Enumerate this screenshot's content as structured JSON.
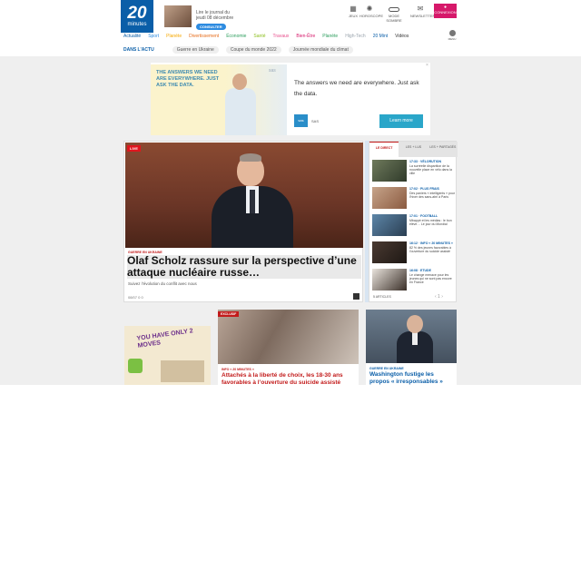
{
  "header": {
    "logo_number": "20",
    "logo_word": "minutes",
    "journal_line1": "Lire le journal du",
    "journal_line2": "jeudi 08 décembre",
    "journal_button": "CONSULTER",
    "tools": [
      {
        "label": "JEUX",
        "icon": "games-icon"
      },
      {
        "label": "HOROSCOPE",
        "icon": "horoscope-icon"
      },
      {
        "label": "MODE SOMBRE",
        "icon": "dark-mode-toggle-icon"
      },
      {
        "label": "NEWSLETTERS",
        "icon": "mail-icon"
      }
    ],
    "login_label": "CONNEXION",
    "nav": [
      "Actualité",
      "Sport",
      "Planète",
      "Voyages",
      "Divertissement",
      "Économie",
      "Santé",
      "Travaux",
      "Bien-Être",
      "Planète",
      "High-Tech",
      "Par Ici",
      "20 Mint",
      "Vidéos"
    ],
    "nav_more_label": "MENU",
    "actu_label": "DANS L'ACTU",
    "actu_pills": [
      "Guerre en Ukraine",
      "Coupe du monde 2022",
      "Journée mondiale du climat"
    ]
  },
  "ad": {
    "headline": "THE ANSWERS WE NEED ARE EVERYWHERE. JUST ASK THE DATA.",
    "brand_small": "sas",
    "text": "The answers we need are everywhere. Just ask the data.",
    "logo": "sas",
    "brand": "SAS",
    "cta": "Learn more",
    "close": "×"
  },
  "main_story": {
    "live_badge": "LIVE",
    "category": "GUERRE EN UKRAINE",
    "title": "Olaf Scholz rassure sur la perspective d’une attaque nucléaire russe…",
    "subtitle": "Suivez l’évolution du conflit avec nous",
    "stats": "08/07  0  0"
  },
  "side": {
    "tabs": [
      "LE DIRECT",
      "LES + LUS",
      "LES + PARTAGÉS"
    ],
    "items": [
      {
        "tag": "17:33 · VÉLORUTION",
        "text": "La surréelle disparition de la nouvelle place en vélo dans la ville"
      },
      {
        "tag": "17:02 · PLUS FRAIS",
        "text": "Des paniers « intelligents » pour l’hiver des sans-abri à Paris"
      },
      {
        "tag": "17:01 · FOOTBALL",
        "text": "Mbappé et les médias : le bon élève… Le jour du Mondial"
      },
      {
        "tag": "16:12 · INFO « 20 MINUTES »",
        "text": "82 % des jeunes favorables à l’ouverture du suicide assisté"
      },
      {
        "tag": "16:08 · ETUDE",
        "text": "Le change menace pour les jeunes qui ne sont pas encore en France"
      }
    ],
    "footer": "5 ARTICLES",
    "pager": "‹  1  ›"
  },
  "cards": {
    "ad_text": "YOU HAVE ONLY 2 MOVES",
    "card2_badge": "EXCLUSIF",
    "card2_category": "INFO « 20 MINUTES »",
    "card2_title": "Attachés à la liberté de choix, les 18-30 ans favorables à l’ouverture du suicide assisté",
    "card3_category": "GUERRE EN UKRAINE",
    "card3_title": "Washington fustige les propos « irresponsables »"
  }
}
